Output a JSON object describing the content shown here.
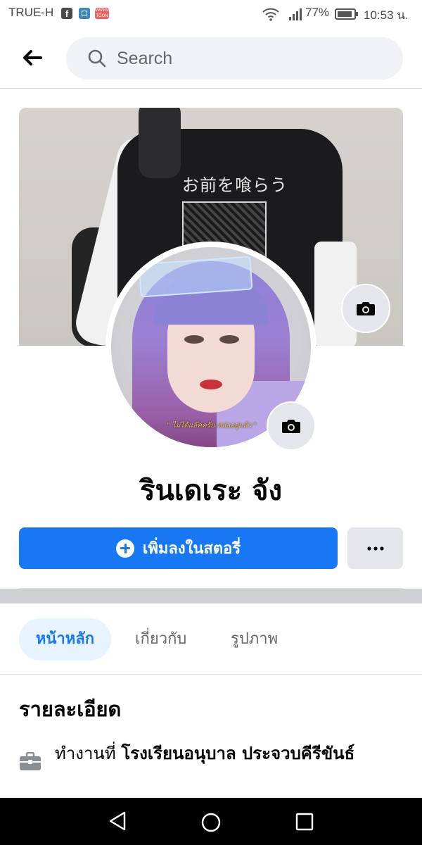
{
  "status_bar": {
    "carrier": "TRUE-H",
    "notification_icons": [
      "facebook-icon",
      "gallery-icon",
      "manga-toon-icon"
    ],
    "manga_icon_text": "MANGA TOON",
    "battery": "77%",
    "time": "10:53 น."
  },
  "header": {
    "back_icon": "arrow-left-icon",
    "search_placeholder": "Search"
  },
  "profile": {
    "cover_print_text": "お前を喰らう",
    "avatar_caption": "\" ไม่ได้แอ๊คครับ หล่ออยู่แล้ว \"",
    "name": "รินเดเระ จัง",
    "add_story_label": "เพิ่มลงในสตอรี่"
  },
  "tabs": [
    {
      "label": "หน้าหลัก",
      "active": true
    },
    {
      "label": "เกี่ยวกับ",
      "active": false
    },
    {
      "label": "รูปภาพ",
      "active": false
    }
  ],
  "details": {
    "title": "รายละเอียด",
    "work_prefix": "ทำงานที่",
    "work_place": "โรงเรียนอนุบาล ประจวบคีรีขันธ์"
  },
  "colors": {
    "accent": "#1877f2",
    "tab_active_bg": "#e7f3ff",
    "secondary_button": "#e4e6eb",
    "divider": "#ced0d4"
  }
}
